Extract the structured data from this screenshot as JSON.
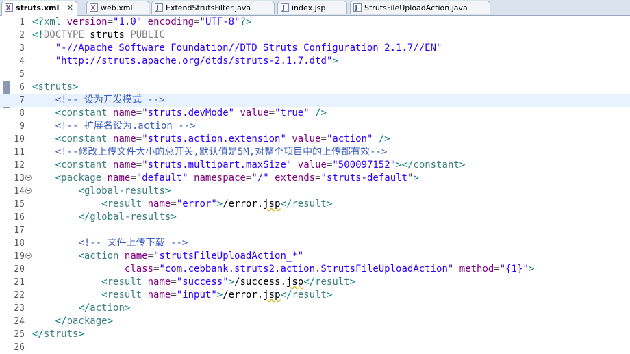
{
  "tabs": [
    {
      "name": "struts.xml",
      "active": true,
      "icon": "xml-file-icon",
      "closable": true
    },
    {
      "name": "web.xml",
      "active": false,
      "icon": "xml-file-icon"
    },
    {
      "name": "ExtendStrutsFilter.java",
      "active": false,
      "icon": "java-file-icon"
    },
    {
      "name": "index.jsp",
      "active": false,
      "icon": "jsp-file-icon"
    },
    {
      "name": "StrutsFileUploadAction.java",
      "active": false,
      "icon": "java-file-icon"
    }
  ],
  "editor": {
    "current_line": 7,
    "fold_lines": [
      13,
      14,
      19
    ],
    "lines": [
      {
        "n": "1",
        "tokens": [
          [
            "br",
            "<?"
          ],
          [
            "tag",
            "xml"
          ],
          [
            "t",
            " "
          ],
          [
            "attr",
            "version"
          ],
          [
            "t",
            "="
          ],
          [
            "val",
            "\"1.0\""
          ],
          [
            "t",
            " "
          ],
          [
            "attr",
            "encoding"
          ],
          [
            "t",
            "="
          ],
          [
            "val",
            "\"UTF-8\""
          ],
          [
            "br",
            "?>"
          ]
        ]
      },
      {
        "n": "2",
        "tokens": [
          [
            "br",
            "<!"
          ],
          [
            "doc",
            "DOCTYPE"
          ],
          [
            "t",
            " struts "
          ],
          [
            "doc",
            "PUBLIC"
          ]
        ]
      },
      {
        "n": "3",
        "tokens": [
          [
            "t",
            "    "
          ],
          [
            "val",
            "\"-//Apache Software Foundation//DTD Struts Configuration 2.1.7//EN\""
          ]
        ]
      },
      {
        "n": "4",
        "tokens": [
          [
            "t",
            "    "
          ],
          [
            "val",
            "\"http://struts.apache.org/dtds/struts-2.1.7.dtd\""
          ],
          [
            "br",
            ">"
          ]
        ]
      },
      {
        "n": "5",
        "tokens": []
      },
      {
        "n": "6",
        "tokens": [
          [
            "br",
            "<"
          ],
          [
            "tag",
            "struts"
          ],
          [
            "br",
            ">"
          ]
        ]
      },
      {
        "n": "7",
        "tokens": [
          [
            "t",
            "    "
          ],
          [
            "com",
            "<!-- 设为开发模式 -->"
          ]
        ]
      },
      {
        "n": "8",
        "tokens": [
          [
            "t",
            "    "
          ],
          [
            "br",
            "<"
          ],
          [
            "tag",
            "constant"
          ],
          [
            "t",
            " "
          ],
          [
            "attr",
            "name"
          ],
          [
            "t",
            "="
          ],
          [
            "val",
            "\"struts.devMode\""
          ],
          [
            "t",
            " "
          ],
          [
            "attr",
            "value"
          ],
          [
            "t",
            "="
          ],
          [
            "val",
            "\"true\""
          ],
          [
            "t",
            " "
          ],
          [
            "br",
            "/>"
          ]
        ]
      },
      {
        "n": "9",
        "tokens": [
          [
            "t",
            "    "
          ],
          [
            "com",
            "<!-- 扩展名设为.action -->"
          ]
        ]
      },
      {
        "n": "10",
        "tokens": [
          [
            "t",
            "    "
          ],
          [
            "br",
            "<"
          ],
          [
            "tag",
            "constant"
          ],
          [
            "t",
            " "
          ],
          [
            "attr",
            "name"
          ],
          [
            "t",
            "="
          ],
          [
            "val",
            "\"struts.action.extension\""
          ],
          [
            "t",
            " "
          ],
          [
            "attr",
            "value"
          ],
          [
            "t",
            "="
          ],
          [
            "val",
            "\"action\""
          ],
          [
            "t",
            " "
          ],
          [
            "br",
            "/>"
          ]
        ]
      },
      {
        "n": "11",
        "tokens": [
          [
            "t",
            "    "
          ],
          [
            "com",
            "<!--修改上传文件大小的总开关,默认值是5M,对整个项目中的上传都有效-->"
          ]
        ]
      },
      {
        "n": "12",
        "tokens": [
          [
            "t",
            "    "
          ],
          [
            "br",
            "<"
          ],
          [
            "tag",
            "constant"
          ],
          [
            "t",
            " "
          ],
          [
            "attr",
            "name"
          ],
          [
            "t",
            "="
          ],
          [
            "val",
            "\"struts.multipart.maxSize\""
          ],
          [
            "t",
            " "
          ],
          [
            "attr",
            "value"
          ],
          [
            "t",
            "="
          ],
          [
            "val",
            "\"500097152\""
          ],
          [
            "br",
            ">"
          ],
          [
            "br",
            "</"
          ],
          [
            "tag",
            "constant"
          ],
          [
            "br",
            ">"
          ]
        ]
      },
      {
        "n": "13",
        "tokens": [
          [
            "t",
            "    "
          ],
          [
            "br",
            "<"
          ],
          [
            "tag",
            "package"
          ],
          [
            "t",
            " "
          ],
          [
            "attr",
            "name"
          ],
          [
            "t",
            "="
          ],
          [
            "val",
            "\"default\""
          ],
          [
            "t",
            " "
          ],
          [
            "attr",
            "namespace"
          ],
          [
            "t",
            "="
          ],
          [
            "val",
            "\"/\""
          ],
          [
            "t",
            " "
          ],
          [
            "attr",
            "extends"
          ],
          [
            "t",
            "="
          ],
          [
            "val",
            "\"struts-default\""
          ],
          [
            "br",
            ">"
          ]
        ]
      },
      {
        "n": "14",
        "tokens": [
          [
            "t",
            "        "
          ],
          [
            "br",
            "<"
          ],
          [
            "tag",
            "global-results"
          ],
          [
            "br",
            ">"
          ]
        ]
      },
      {
        "n": "15",
        "tokens": [
          [
            "t",
            "            "
          ],
          [
            "br",
            "<"
          ],
          [
            "tag",
            "result"
          ],
          [
            "t",
            " "
          ],
          [
            "attr",
            "name"
          ],
          [
            "t",
            "="
          ],
          [
            "val",
            "\"error\""
          ],
          [
            "br",
            ">"
          ],
          [
            "t",
            "/error."
          ],
          [
            "sq",
            "jsp"
          ],
          [
            "br",
            "</"
          ],
          [
            "tag",
            "result"
          ],
          [
            "br",
            ">"
          ]
        ]
      },
      {
        "n": "16",
        "tokens": [
          [
            "t",
            "        "
          ],
          [
            "br",
            "</"
          ],
          [
            "tag",
            "global-results"
          ],
          [
            "br",
            ">"
          ]
        ]
      },
      {
        "n": "17",
        "tokens": []
      },
      {
        "n": "18",
        "tokens": [
          [
            "t",
            "        "
          ],
          [
            "com",
            "<!-- 文件上传下载 -->"
          ]
        ]
      },
      {
        "n": "19",
        "tokens": [
          [
            "t",
            "        "
          ],
          [
            "br",
            "<"
          ],
          [
            "tag",
            "action"
          ],
          [
            "t",
            " "
          ],
          [
            "attr",
            "name"
          ],
          [
            "t",
            "="
          ],
          [
            "val",
            "\"strutsFileUploadAction_*\""
          ]
        ]
      },
      {
        "n": "20",
        "tokens": [
          [
            "t",
            "                "
          ],
          [
            "attr",
            "class"
          ],
          [
            "t",
            "="
          ],
          [
            "val",
            "\"com.cebbank.struts2.action.StrutsFileUploadAction\""
          ],
          [
            "t",
            " "
          ],
          [
            "attr",
            "method"
          ],
          [
            "t",
            "="
          ],
          [
            "val",
            "\"{1}\""
          ],
          [
            "br",
            ">"
          ]
        ]
      },
      {
        "n": "21",
        "tokens": [
          [
            "t",
            "            "
          ],
          [
            "br",
            "<"
          ],
          [
            "tag",
            "result"
          ],
          [
            "t",
            " "
          ],
          [
            "attr",
            "name"
          ],
          [
            "t",
            "="
          ],
          [
            "val",
            "\"success\""
          ],
          [
            "br",
            ">"
          ],
          [
            "t",
            "/success."
          ],
          [
            "sq",
            "jsp"
          ],
          [
            "br",
            "</"
          ],
          [
            "tag",
            "result"
          ],
          [
            "br",
            ">"
          ]
        ]
      },
      {
        "n": "22",
        "tokens": [
          [
            "t",
            "            "
          ],
          [
            "br",
            "<"
          ],
          [
            "tag",
            "result"
          ],
          [
            "t",
            " "
          ],
          [
            "attr",
            "name"
          ],
          [
            "t",
            "="
          ],
          [
            "val",
            "\"input\""
          ],
          [
            "br",
            ">"
          ],
          [
            "t",
            "/error."
          ],
          [
            "sq",
            "jsp"
          ],
          [
            "br",
            "</"
          ],
          [
            "tag",
            "result"
          ],
          [
            "br",
            ">"
          ]
        ]
      },
      {
        "n": "23",
        "tokens": [
          [
            "t",
            "        "
          ],
          [
            "br",
            "</"
          ],
          [
            "tag",
            "action"
          ],
          [
            "br",
            ">"
          ]
        ]
      },
      {
        "n": "24",
        "tokens": [
          [
            "t",
            "    "
          ],
          [
            "br",
            "</"
          ],
          [
            "tag",
            "package"
          ],
          [
            "br",
            ">"
          ]
        ]
      },
      {
        "n": "25",
        "tokens": [
          [
            "br",
            "</"
          ],
          [
            "tag",
            "struts"
          ],
          [
            "br",
            ">"
          ]
        ]
      },
      {
        "n": "26",
        "tokens": []
      }
    ]
  },
  "colors": {
    "bracket": "#008080",
    "tag": "#3f7f7f",
    "attribute": "#7f007f",
    "value": "#2a00ff",
    "comment": "#3f5fbf",
    "doctype": "#808080",
    "current_line": "#e8f2fe",
    "tab_bar": "#dbe3ef"
  }
}
